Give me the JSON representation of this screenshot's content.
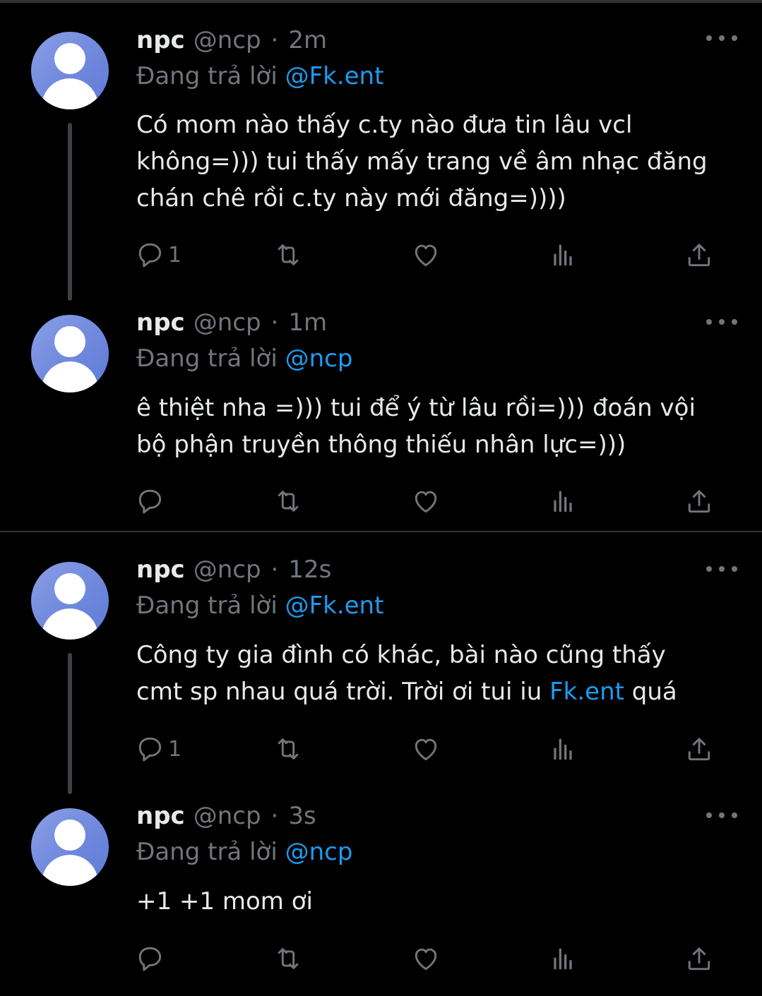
{
  "tweets": [
    {
      "name": "npc",
      "handle": "@ncp",
      "time": "2m",
      "reply_prefix": "Đang trả lời ",
      "reply_to": "@Fk.ent",
      "text_lines": [
        "Có mom nào thấy c.ty nào đưa tin lâu vcl",
        "không=))) tui thấy mấy trang về âm nhạc đăng",
        "chán chê rồi c.ty này mới đăng=))))"
      ],
      "reply_count": "1"
    },
    {
      "name": "npc",
      "handle": "@ncp",
      "time": "1m",
      "reply_prefix": "Đang trả lời ",
      "reply_to": "@ncp",
      "text_lines": [
        "ê thiệt nha =))) tui để ý từ lâu rồi=))) đoán vội",
        "bộ phận truyền thông thiếu nhân lực=)))"
      ],
      "reply_count": ""
    },
    {
      "name": "npc",
      "handle": "@ncp",
      "time": "12s",
      "reply_prefix": "Đang trả lời ",
      "reply_to": "@Fk.ent",
      "text_lines": [
        "Công ty gia đình có khác, bài nào cũng thấy"
      ],
      "text_line2_before": "cmt sp nhau quá trời. Trời ơi tui iu ",
      "text_line2_link": "Fk.ent",
      "text_line2_after": " quá",
      "reply_count": "1"
    },
    {
      "name": "npc",
      "handle": "@ncp",
      "time": "3s",
      "reply_prefix": "Đang trả lời ",
      "reply_to": "@ncp",
      "text_lines": [
        "+1 +1 mom ơi"
      ],
      "reply_count": ""
    }
  ],
  "separator_dot": "·",
  "colors": {
    "background": "#000000",
    "text": "#e7e9ea",
    "muted": "#71767b",
    "link": "#1d9bf0",
    "avatar": "#7088dd"
  },
  "icons": [
    "reply-icon",
    "retweet-icon",
    "like-icon",
    "views-icon",
    "share-icon",
    "more-icon",
    "avatar-icon"
  ]
}
